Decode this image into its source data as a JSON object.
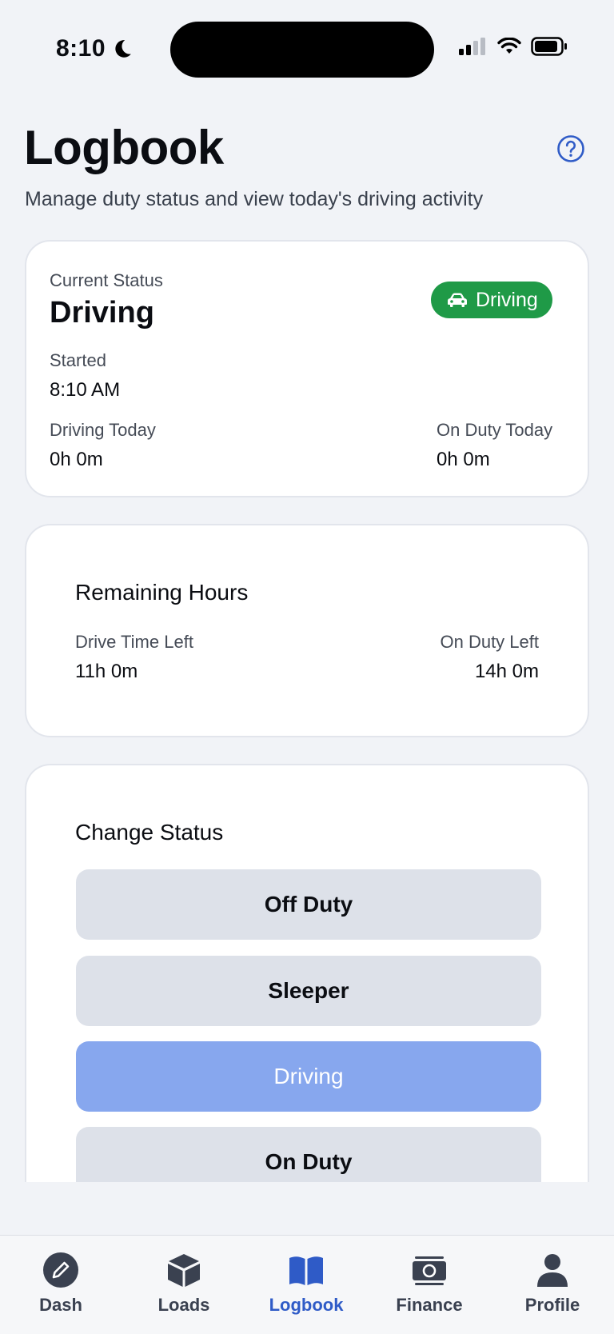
{
  "status_bar": {
    "time": "8:10"
  },
  "header": {
    "title": "Logbook",
    "subtitle": "Manage duty status and view today's driving activity"
  },
  "current_status": {
    "label": "Current Status",
    "value": "Driving",
    "badge": "Driving",
    "started_label": "Started",
    "started_value": "8:10 AM",
    "driving_today_label": "Driving Today",
    "driving_today_value": "0h 0m",
    "on_duty_today_label": "On Duty Today",
    "on_duty_today_value": "0h 0m"
  },
  "remaining": {
    "title": "Remaining Hours",
    "drive_left_label": "Drive Time Left",
    "drive_left_value": "11h 0m",
    "duty_left_label": "On Duty Left",
    "duty_left_value": "14h 0m"
  },
  "change_status": {
    "title": "Change Status",
    "options": [
      {
        "label": "Off Duty"
      },
      {
        "label": "Sleeper"
      },
      {
        "label": "Driving"
      },
      {
        "label": "On Duty"
      }
    ],
    "selected": "Driving"
  },
  "tabs": [
    {
      "label": "Dash",
      "icon": "pencil-circle-icon"
    },
    {
      "label": "Loads",
      "icon": "box-icon"
    },
    {
      "label": "Logbook",
      "icon": "book-icon"
    },
    {
      "label": "Finance",
      "icon": "banknote-icon"
    },
    {
      "label": "Profile",
      "icon": "person-icon"
    }
  ],
  "active_tab": "Logbook",
  "colors": {
    "accent": "#2f5bc7",
    "driving_badge": "#1f9a47",
    "selected_button": "#87a7ee",
    "button": "#dde1e9",
    "background": "#f1f3f7"
  }
}
